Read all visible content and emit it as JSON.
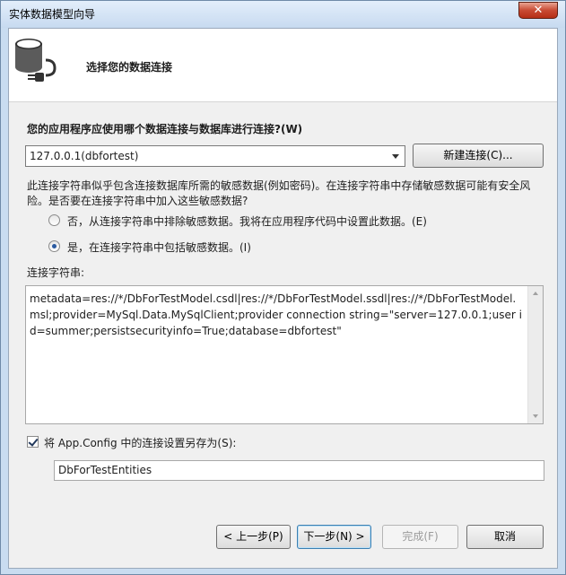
{
  "window": {
    "title": "实体数据模型向导",
    "close_glyph": "✕"
  },
  "header": {
    "title": "选择您的数据连接",
    "icon": "database-plug-icon"
  },
  "connection": {
    "question": "您的应用程序应使用哪个数据连接与数据库进行连接?(W)",
    "selected": "127.0.0.1(dbfortest)",
    "new_button": "新建连接(C)..."
  },
  "sensitive": {
    "warning": "此连接字符串似乎包含连接数据库所需的敏感数据(例如密码)。在连接字符串中存储敏感数据可能有安全风险。是否要在连接字符串中加入这些敏感数据?",
    "option_exclude": "否，从连接字符串中排除敏感数据。我将在应用程序代码中设置此数据。(E)",
    "option_include": "是，在连接字符串中包括敏感数据。(I)",
    "selected": "include"
  },
  "connection_string": {
    "label": "连接字符串:",
    "value": "metadata=res://*/DbForTestModel.csdl|res://*/DbForTestModel.ssdl|res://*/DbForTestModel.msl;provider=MySql.Data.MySqlClient;provider connection string=\"server=127.0.0.1;user id=summer;persistsecurityinfo=True;database=dbfortest\""
  },
  "save_config": {
    "checked": true,
    "label": "将 App.Config 中的连接设置另存为(S):",
    "entity_name": "DbForTestEntities"
  },
  "footer": {
    "back": "< 上一步(P)",
    "next": "下一步(N) >",
    "finish": "完成(F)",
    "cancel": "取消"
  }
}
